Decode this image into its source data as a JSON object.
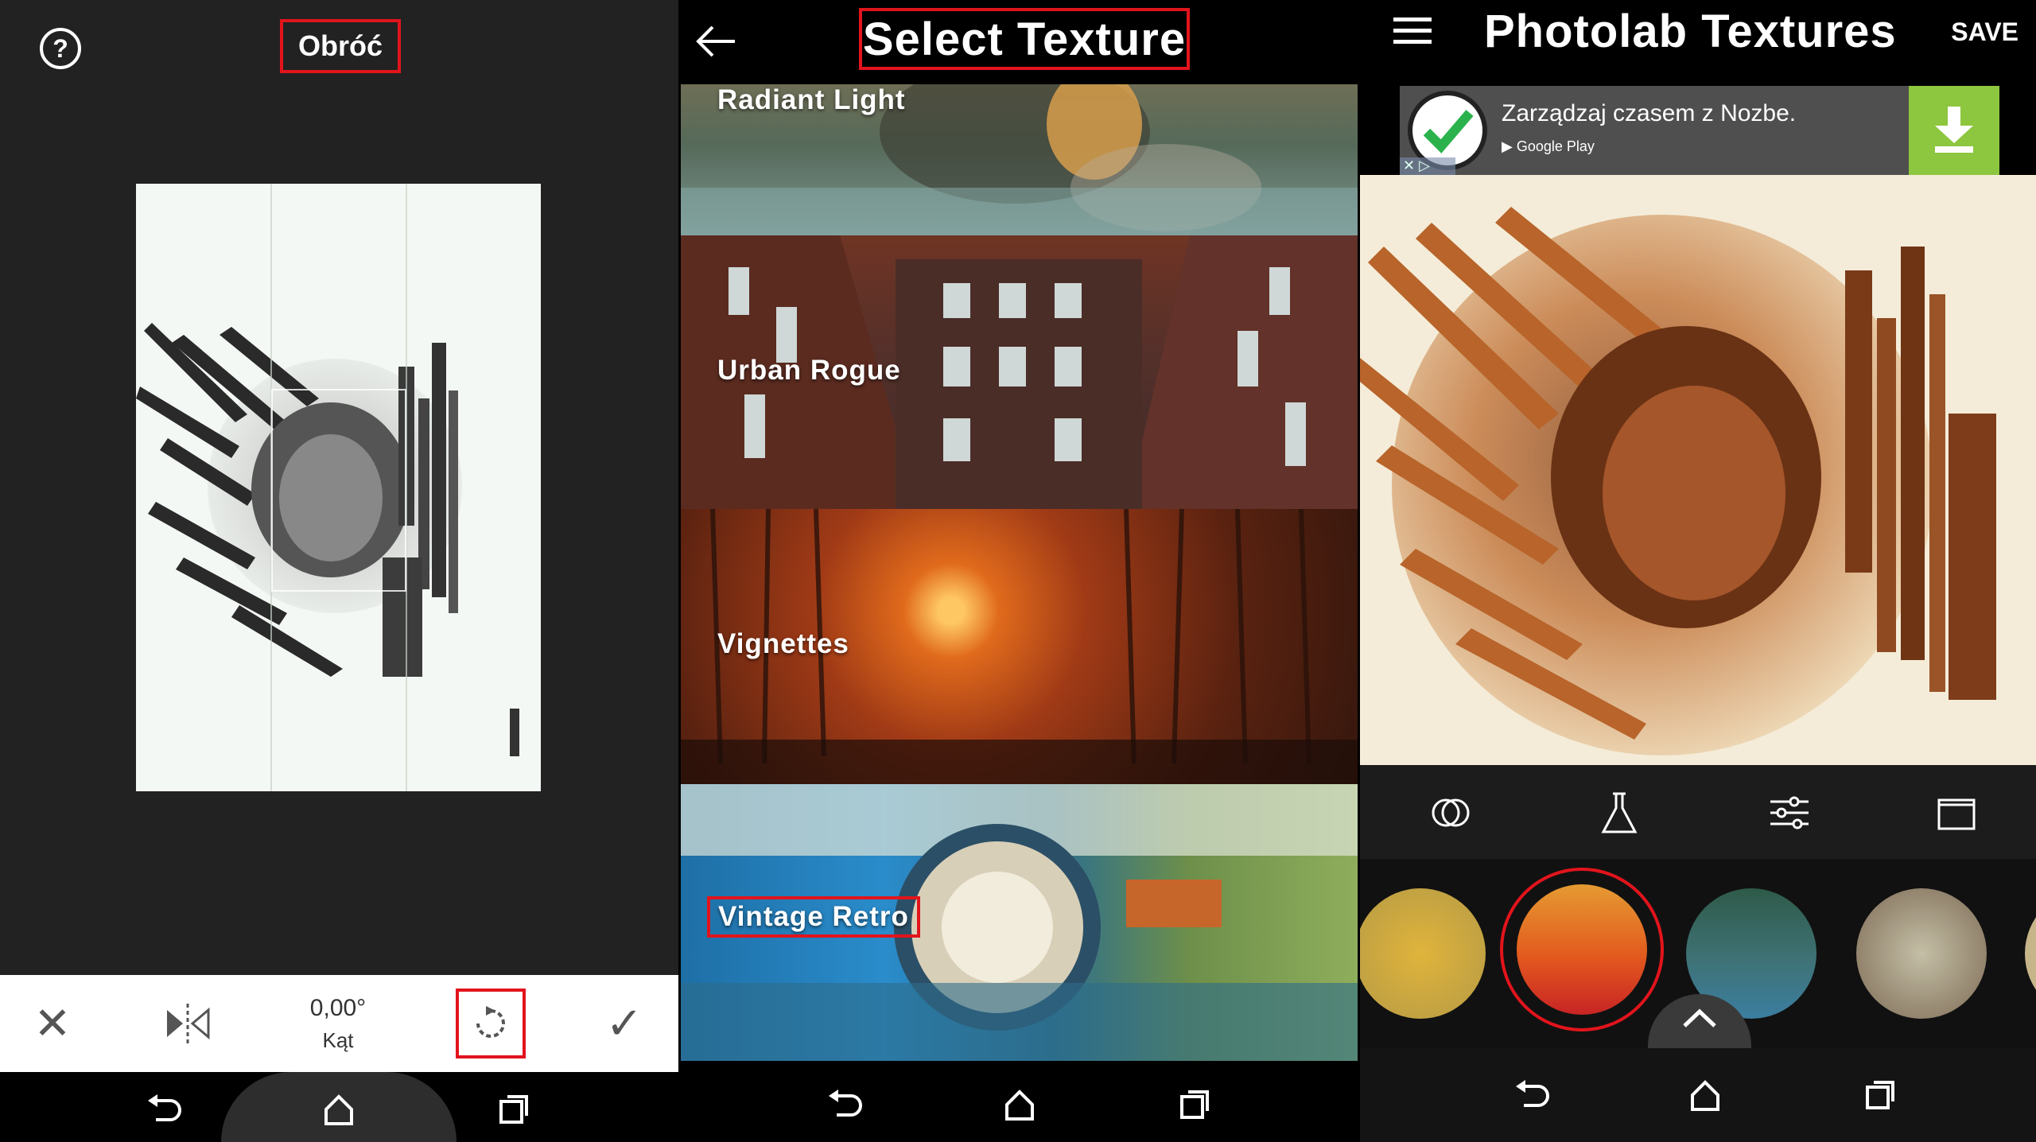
{
  "panel1": {
    "help_icon": "?",
    "title": "Obróć",
    "toolbar": {
      "angle_value": "0,00°",
      "angle_label": "Kąt"
    }
  },
  "panel2": {
    "title": "Select Texture",
    "textures": [
      {
        "label": "Radiant Light"
      },
      {
        "label": "Urban Rogue"
      },
      {
        "label": "Vignettes"
      },
      {
        "label": "Vintage Retro"
      }
    ]
  },
  "panel3": {
    "title": "Photolab Textures",
    "save_label": "SAVE",
    "ad": {
      "text": "Zarządzaj czasem z Nozbe.",
      "store": "Google Play",
      "download_color": "#8dc63f"
    },
    "swatches": [
      {
        "color": "#d4a940"
      },
      {
        "color": "#e35a1e",
        "selected": true
      },
      {
        "color": "#3f6f6e"
      },
      {
        "color": "#9a8f78"
      }
    ]
  },
  "colors": {
    "highlight": "#e2141c",
    "panel_bg": "#222222"
  }
}
